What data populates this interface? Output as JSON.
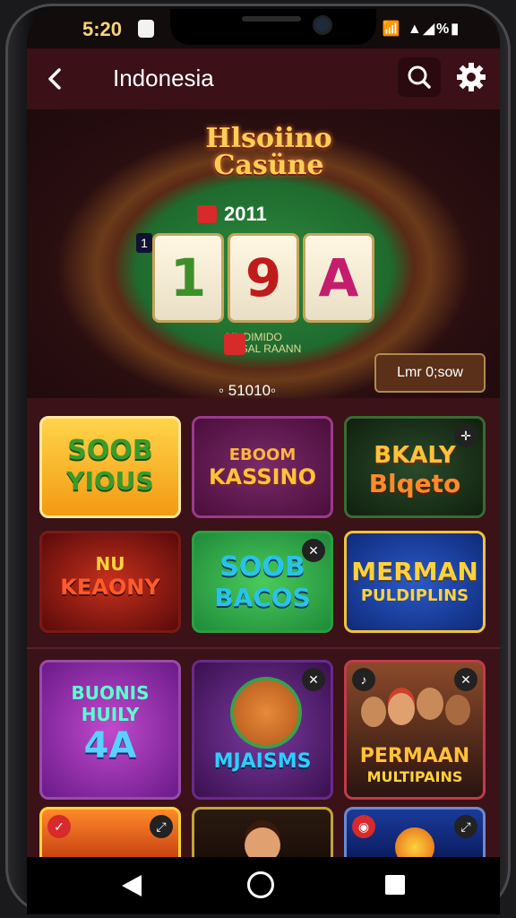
{
  "status": {
    "time": "5:20",
    "icons": "📶 ▲◢%▮"
  },
  "appbar": {
    "title": "Indonesia"
  },
  "hero": {
    "title_line1": "Hlsoiino",
    "title_line2": "Casüne",
    "year": "2011",
    "reel_side": "1",
    "reels": [
      "1",
      "9",
      "A"
    ],
    "sub_line1": "ML DIMIDO",
    "sub_line2": "CASAL RAANN",
    "button": "Lmr 0;sow",
    "counter": "◦ 51010◦"
  },
  "tiles": [
    {
      "t1": "SOOB",
      "t2": "YIOUS"
    },
    {
      "t1": "EBOOM",
      "t2": "KASSINO"
    },
    {
      "t1": "BKALY",
      "t2": "Blqeto"
    },
    {
      "t1": "NU",
      "t2": "KEAONY"
    },
    {
      "t1": "SOOB",
      "t2": "BACOS"
    },
    {
      "t1": "MERMAN",
      "t2": "PULDIPLINS"
    },
    {
      "t1": "BUONIS HUILY",
      "t2": "4A"
    },
    {
      "t1": "",
      "t2": "MJAISMS"
    },
    {
      "t1": "PERMAAN",
      "t2": "MULTIPAINS"
    }
  ],
  "colors": {
    "accent": "#f7d478",
    "background": "#3a1218"
  }
}
